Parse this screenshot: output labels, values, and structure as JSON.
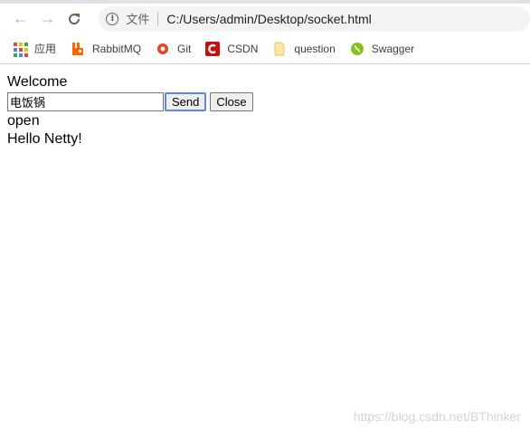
{
  "browser": {
    "scheme_label": "文件",
    "url": "C:/Users/admin/Desktop/socket.html"
  },
  "bookmarks": [
    {
      "label": "应用",
      "icon": "apps-grid-icon"
    },
    {
      "label": "RabbitMQ",
      "icon": "rabbitmq-icon",
      "color": "#ff6600"
    },
    {
      "label": "Git",
      "icon": "git-gear-icon",
      "color": "#e24329"
    },
    {
      "label": "CSDN",
      "icon": "csdn-icon",
      "color": "#c90e0e"
    },
    {
      "label": "question",
      "icon": "folder-icon",
      "color": "#f7d774"
    },
    {
      "label": "Swagger",
      "icon": "swagger-icon",
      "color": "#85c020"
    }
  ],
  "page": {
    "heading": "Welcome",
    "input_value": "电饭锅",
    "send_label": "Send",
    "close_label": "Close",
    "messages": [
      "open",
      "Hello Netty!"
    ]
  },
  "watermark": "https://blog.csdn.net/BThinker"
}
